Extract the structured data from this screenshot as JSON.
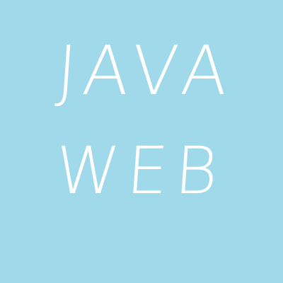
{
  "title": {
    "line1": "JAVA",
    "line2": "WEB"
  },
  "colors": {
    "background": "#9fd9ea",
    "text": "#ffffff"
  }
}
